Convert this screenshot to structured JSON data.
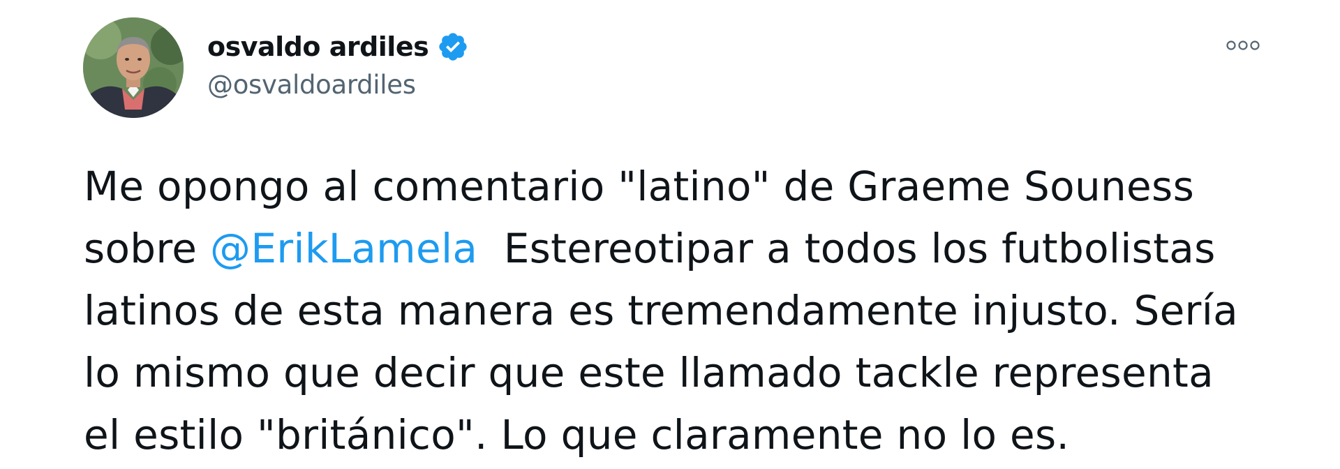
{
  "author": {
    "name": "osvaldo ardiles",
    "handle": "@osvaldoardiles",
    "verified_icon": "verified-badge-icon",
    "avatar_icon": "profile-avatar"
  },
  "more_icon": "more-options-icon",
  "tweet": {
    "line1": "Me opongo al comentario \"latino\" de Graeme Souness",
    "line2_prefix": "sobre ",
    "line2_mention": "@ErikLamela",
    "line2_suffix": "  Estereotipar a todos los futbolistas",
    "line3": "latinos de esta manera es tremendamente injusto. Sería",
    "line4": "lo mismo que decir que este llamado tackle representa",
    "line5": "el estilo \"británico\". Lo que claramente no lo es."
  },
  "colors": {
    "text": "#0f1419",
    "secondary_text": "#536471",
    "link": "#1d9bf0",
    "verified": "#1d9bf0",
    "background": "#ffffff"
  }
}
